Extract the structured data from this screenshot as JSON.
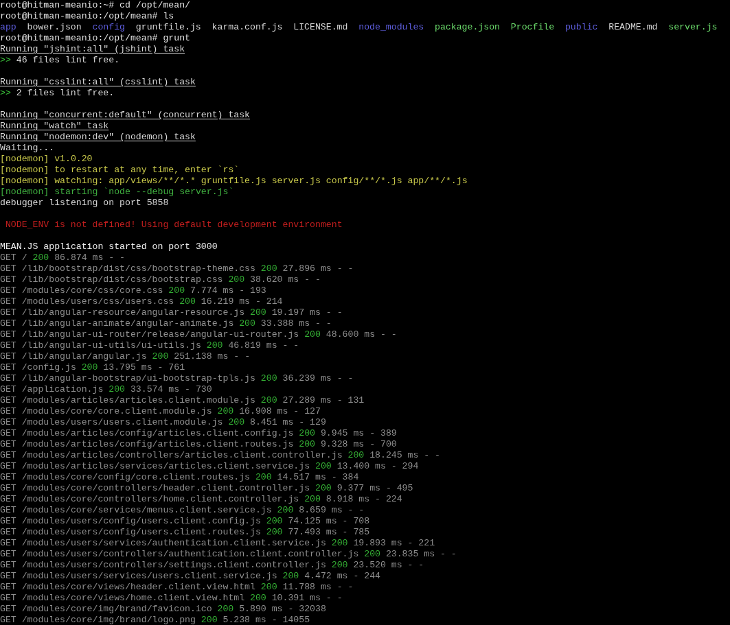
{
  "terminal": {
    "lines": [
      {
        "kind": "text",
        "segments": [
          {
            "kind": "prompt",
            "text": "root@hitman-meanio:~# cd /opt/mean/"
          }
        ]
      },
      {
        "kind": "text",
        "segments": [
          {
            "kind": "prompt",
            "text": "root@hitman-meanio:/opt/mean# ls"
          }
        ]
      },
      {
        "kind": "listing",
        "segments": [
          {
            "kind": "dir",
            "text": "app"
          },
          {
            "kind": "file",
            "text": "bower.json"
          },
          {
            "kind": "dir",
            "text": "config"
          },
          {
            "kind": "file",
            "text": "gruntfile.js"
          },
          {
            "kind": "file",
            "text": "karma.conf.js"
          },
          {
            "kind": "file",
            "text": "LICENSE.md"
          },
          {
            "kind": "dir",
            "text": "node_modules"
          },
          {
            "kind": "exec",
            "text": "package.json"
          },
          {
            "kind": "exec",
            "text": "Procfile"
          },
          {
            "kind": "dir",
            "text": "public"
          },
          {
            "kind": "file",
            "text": "README.md"
          },
          {
            "kind": "exec",
            "text": "server.js"
          }
        ]
      },
      {
        "kind": "text",
        "segments": [
          {
            "kind": "prompt",
            "text": "root@hitman-meanio:/opt/mean# grunt"
          }
        ]
      },
      {
        "kind": "text",
        "segments": [
          {
            "kind": "heading",
            "text": "Running \"jshint:all\" (jshint) task"
          }
        ]
      },
      {
        "kind": "text",
        "segments": [
          {
            "kind": "marker",
            "text": ">>"
          },
          {
            "kind": "plain",
            "text": "46 files lint free."
          }
        ]
      },
      {
        "kind": "blank"
      },
      {
        "kind": "text",
        "segments": [
          {
            "kind": "heading",
            "text": "Running \"csslint:all\" (csslint) task"
          }
        ]
      },
      {
        "kind": "text",
        "segments": [
          {
            "kind": "marker",
            "text": ">>"
          },
          {
            "kind": "plain",
            "text": "2 files lint free."
          }
        ]
      },
      {
        "kind": "blank"
      },
      {
        "kind": "text",
        "segments": [
          {
            "kind": "heading",
            "text": "Running \"concurrent:default\" (concurrent) task"
          }
        ]
      },
      {
        "kind": "text",
        "segments": [
          {
            "kind": "heading",
            "text": "Running \"watch\" task"
          }
        ]
      },
      {
        "kind": "text",
        "segments": [
          {
            "kind": "heading",
            "text": "Running \"nodemon:dev\" (nodemon) task"
          }
        ]
      },
      {
        "kind": "text",
        "segments": [
          {
            "kind": "plain",
            "text": "Waiting..."
          }
        ]
      },
      {
        "kind": "text",
        "segments": [
          {
            "kind": "note",
            "text": "[nodemon] v1.0.20"
          }
        ]
      },
      {
        "kind": "text",
        "segments": [
          {
            "kind": "note",
            "text": "[nodemon] to restart at any time, enter `rs`"
          }
        ]
      },
      {
        "kind": "text",
        "segments": [
          {
            "kind": "note",
            "text": "[nodemon] watching: app/views/**/*.* gruntfile.js server.js config/**/*.js app/**/*.js"
          }
        ]
      },
      {
        "kind": "text",
        "segments": [
          {
            "kind": "started",
            "text": "[nodemon] starting `node --debug server.js`"
          }
        ]
      },
      {
        "kind": "text",
        "segments": [
          {
            "kind": "plain",
            "text": "debugger listening on port 5858"
          }
        ]
      },
      {
        "kind": "blank"
      },
      {
        "kind": "indented",
        "segments": [
          {
            "kind": "error",
            "text": "NODE_ENV is not defined! Using default development environment"
          }
        ]
      },
      {
        "kind": "blank"
      },
      {
        "kind": "text",
        "segments": [
          {
            "kind": "bright",
            "text": "MEAN.JS application started on port 3000"
          }
        ]
      },
      {
        "kind": "text",
        "segments": [
          {
            "kind": "request",
            "text": "GET /"
          },
          {
            "kind": "status",
            "text": "200"
          },
          {
            "kind": "timing",
            "text": "86.874 ms - -"
          }
        ]
      },
      {
        "kind": "text",
        "segments": [
          {
            "kind": "request",
            "text": "GET /lib/bootstrap/dist/css/bootstrap-theme.css"
          },
          {
            "kind": "status",
            "text": "200"
          },
          {
            "kind": "timing",
            "text": "27.896 ms - -"
          }
        ]
      },
      {
        "kind": "text",
        "segments": [
          {
            "kind": "request",
            "text": "GET /lib/bootstrap/dist/css/bootstrap.css"
          },
          {
            "kind": "status",
            "text": "200"
          },
          {
            "kind": "timing",
            "text": "38.620 ms - -"
          }
        ]
      },
      {
        "kind": "text",
        "segments": [
          {
            "kind": "request",
            "text": "GET /modules/core/css/core.css"
          },
          {
            "kind": "status",
            "text": "200"
          },
          {
            "kind": "timing",
            "text": "7.774 ms - 193"
          }
        ]
      },
      {
        "kind": "text",
        "segments": [
          {
            "kind": "request",
            "text": "GET /modules/users/css/users.css"
          },
          {
            "kind": "status",
            "text": "200"
          },
          {
            "kind": "timing",
            "text": "16.219 ms - 214"
          }
        ]
      },
      {
        "kind": "text",
        "segments": [
          {
            "kind": "request",
            "text": "GET /lib/angular-resource/angular-resource.js"
          },
          {
            "kind": "status",
            "text": "200"
          },
          {
            "kind": "timing",
            "text": "19.197 ms - -"
          }
        ]
      },
      {
        "kind": "text",
        "segments": [
          {
            "kind": "request",
            "text": "GET /lib/angular-animate/angular-animate.js"
          },
          {
            "kind": "status",
            "text": "200"
          },
          {
            "kind": "timing",
            "text": "33.388 ms - -"
          }
        ]
      },
      {
        "kind": "text",
        "segments": [
          {
            "kind": "request",
            "text": "GET /lib/angular-ui-router/release/angular-ui-router.js"
          },
          {
            "kind": "status",
            "text": "200"
          },
          {
            "kind": "timing",
            "text": "48.600 ms - -"
          }
        ]
      },
      {
        "kind": "text",
        "segments": [
          {
            "kind": "request",
            "text": "GET /lib/angular-ui-utils/ui-utils.js"
          },
          {
            "kind": "status",
            "text": "200"
          },
          {
            "kind": "timing",
            "text": "46.819 ms - -"
          }
        ]
      },
      {
        "kind": "text",
        "segments": [
          {
            "kind": "request",
            "text": "GET /lib/angular/angular.js"
          },
          {
            "kind": "status",
            "text": "200"
          },
          {
            "kind": "timing",
            "text": "251.138 ms - -"
          }
        ]
      },
      {
        "kind": "text",
        "segments": [
          {
            "kind": "request",
            "text": "GET /config.js"
          },
          {
            "kind": "status",
            "text": "200"
          },
          {
            "kind": "timing",
            "text": "13.795 ms - 761"
          }
        ]
      },
      {
        "kind": "text",
        "segments": [
          {
            "kind": "request",
            "text": "GET /lib/angular-bootstrap/ui-bootstrap-tpls.js"
          },
          {
            "kind": "status",
            "text": "200"
          },
          {
            "kind": "timing",
            "text": "36.239 ms - -"
          }
        ]
      },
      {
        "kind": "text",
        "segments": [
          {
            "kind": "request",
            "text": "GET /application.js"
          },
          {
            "kind": "status",
            "text": "200"
          },
          {
            "kind": "timing",
            "text": "33.574 ms - 730"
          }
        ]
      },
      {
        "kind": "text",
        "segments": [
          {
            "kind": "request",
            "text": "GET /modules/articles/articles.client.module.js"
          },
          {
            "kind": "status",
            "text": "200"
          },
          {
            "kind": "timing",
            "text": "27.289 ms - 131"
          }
        ]
      },
      {
        "kind": "text",
        "segments": [
          {
            "kind": "request",
            "text": "GET /modules/core/core.client.module.js"
          },
          {
            "kind": "status",
            "text": "200"
          },
          {
            "kind": "timing",
            "text": "16.908 ms - 127"
          }
        ]
      },
      {
        "kind": "text",
        "segments": [
          {
            "kind": "request",
            "text": "GET /modules/users/users.client.module.js"
          },
          {
            "kind": "status",
            "text": "200"
          },
          {
            "kind": "timing",
            "text": "8.451 ms - 129"
          }
        ]
      },
      {
        "kind": "text",
        "segments": [
          {
            "kind": "request",
            "text": "GET /modules/articles/config/articles.client.config.js"
          },
          {
            "kind": "status",
            "text": "200"
          },
          {
            "kind": "timing",
            "text": "9.945 ms - 389"
          }
        ]
      },
      {
        "kind": "text",
        "segments": [
          {
            "kind": "request",
            "text": "GET /modules/articles/config/articles.client.routes.js"
          },
          {
            "kind": "status",
            "text": "200"
          },
          {
            "kind": "timing",
            "text": "9.328 ms - 700"
          }
        ]
      },
      {
        "kind": "text",
        "segments": [
          {
            "kind": "request",
            "text": "GET /modules/articles/controllers/articles.client.controller.js"
          },
          {
            "kind": "status",
            "text": "200"
          },
          {
            "kind": "timing",
            "text": "18.245 ms - -"
          }
        ]
      },
      {
        "kind": "text",
        "segments": [
          {
            "kind": "request",
            "text": "GET /modules/articles/services/articles.client.service.js"
          },
          {
            "kind": "status",
            "text": "200"
          },
          {
            "kind": "timing",
            "text": "13.400 ms - 294"
          }
        ]
      },
      {
        "kind": "text",
        "segments": [
          {
            "kind": "request",
            "text": "GET /modules/core/config/core.client.routes.js"
          },
          {
            "kind": "status",
            "text": "200"
          },
          {
            "kind": "timing",
            "text": "14.517 ms - 384"
          }
        ]
      },
      {
        "kind": "text",
        "segments": [
          {
            "kind": "request",
            "text": "GET /modules/core/controllers/header.client.controller.js"
          },
          {
            "kind": "status",
            "text": "200"
          },
          {
            "kind": "timing",
            "text": "9.377 ms - 495"
          }
        ]
      },
      {
        "kind": "text",
        "segments": [
          {
            "kind": "request",
            "text": "GET /modules/core/controllers/home.client.controller.js"
          },
          {
            "kind": "status",
            "text": "200"
          },
          {
            "kind": "timing",
            "text": "8.918 ms - 224"
          }
        ]
      },
      {
        "kind": "text",
        "segments": [
          {
            "kind": "request",
            "text": "GET /modules/core/services/menus.client.service.js"
          },
          {
            "kind": "status",
            "text": "200"
          },
          {
            "kind": "timing",
            "text": "8.659 ms - -"
          }
        ]
      },
      {
        "kind": "text",
        "segments": [
          {
            "kind": "request",
            "text": "GET /modules/users/config/users.client.config.js"
          },
          {
            "kind": "status",
            "text": "200"
          },
          {
            "kind": "timing",
            "text": "74.125 ms - 708"
          }
        ]
      },
      {
        "kind": "text",
        "segments": [
          {
            "kind": "request",
            "text": "GET /modules/users/config/users.client.routes.js"
          },
          {
            "kind": "status",
            "text": "200"
          },
          {
            "kind": "timing",
            "text": "77.493 ms - 785"
          }
        ]
      },
      {
        "kind": "text",
        "segments": [
          {
            "kind": "request",
            "text": "GET /modules/users/services/authentication.client.service.js"
          },
          {
            "kind": "status",
            "text": "200"
          },
          {
            "kind": "timing",
            "text": "19.893 ms - 221"
          }
        ]
      },
      {
        "kind": "text",
        "segments": [
          {
            "kind": "request",
            "text": "GET /modules/users/controllers/authentication.client.controller.js"
          },
          {
            "kind": "status",
            "text": "200"
          },
          {
            "kind": "timing",
            "text": "23.835 ms - -"
          }
        ]
      },
      {
        "kind": "text",
        "segments": [
          {
            "kind": "request",
            "text": "GET /modules/users/controllers/settings.client.controller.js"
          },
          {
            "kind": "status",
            "text": "200"
          },
          {
            "kind": "timing",
            "text": "23.520 ms - -"
          }
        ]
      },
      {
        "kind": "text",
        "segments": [
          {
            "kind": "request",
            "text": "GET /modules/users/services/users.client.service.js"
          },
          {
            "kind": "status",
            "text": "200"
          },
          {
            "kind": "timing",
            "text": "4.472 ms - 244"
          }
        ]
      },
      {
        "kind": "text",
        "segments": [
          {
            "kind": "request",
            "text": "GET /modules/core/views/header.client.view.html"
          },
          {
            "kind": "status",
            "text": "200"
          },
          {
            "kind": "timing",
            "text": "11.788 ms - -"
          }
        ]
      },
      {
        "kind": "text",
        "segments": [
          {
            "kind": "request",
            "text": "GET /modules/core/views/home.client.view.html"
          },
          {
            "kind": "status",
            "text": "200"
          },
          {
            "kind": "timing",
            "text": "10.391 ms - -"
          }
        ]
      },
      {
        "kind": "text",
        "segments": [
          {
            "kind": "request",
            "text": "GET /modules/core/img/brand/favicon.ico"
          },
          {
            "kind": "status",
            "text": "200"
          },
          {
            "kind": "timing",
            "text": "5.890 ms - 32038"
          }
        ]
      },
      {
        "kind": "text",
        "segments": [
          {
            "kind": "request",
            "text": "GET /modules/core/img/brand/logo.png"
          },
          {
            "kind": "status",
            "text": "200"
          },
          {
            "kind": "timing",
            "text": "5.238 ms - 14055"
          }
        ]
      }
    ]
  }
}
